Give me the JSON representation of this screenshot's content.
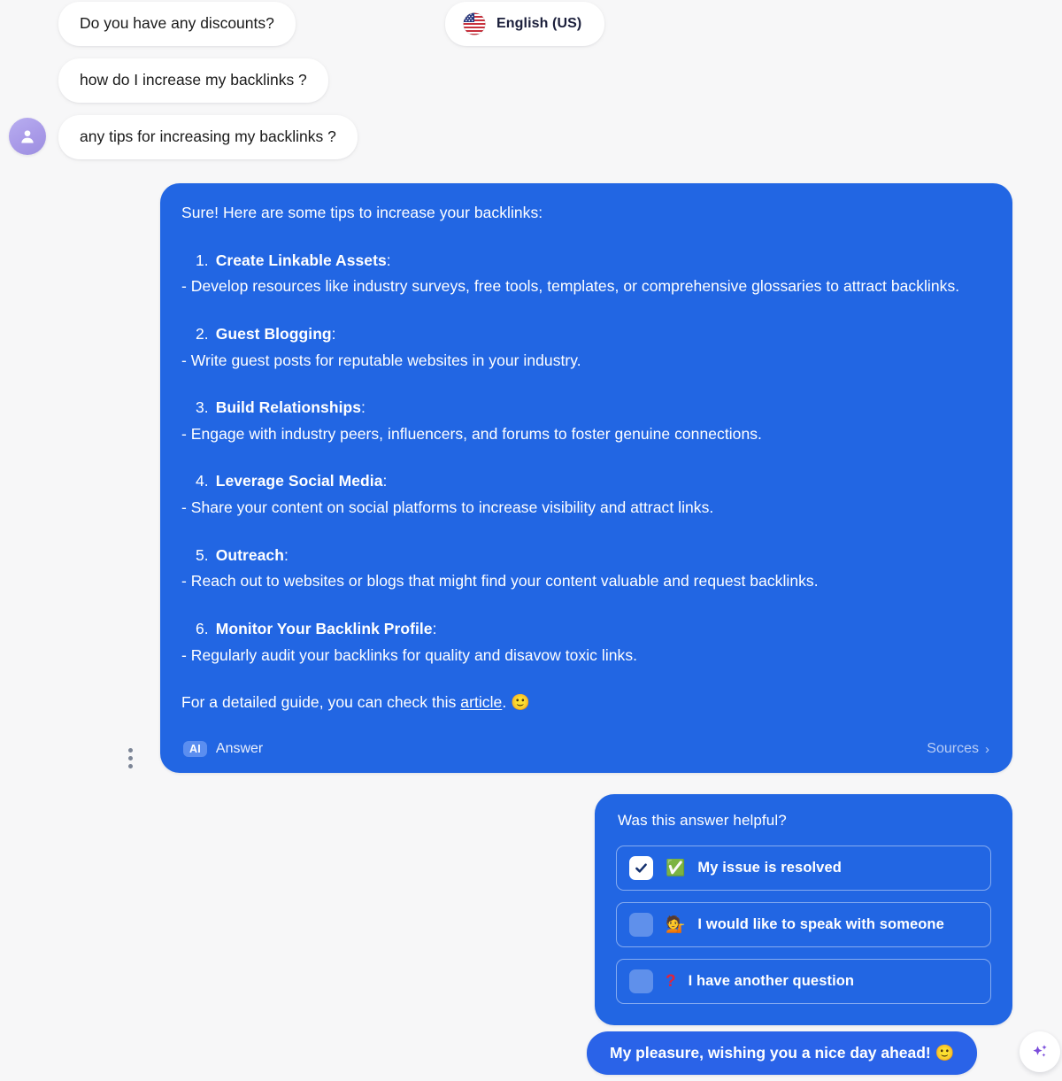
{
  "language_selector": {
    "label": "English (US)",
    "flag_icon": "us-flag-icon"
  },
  "user_messages": [
    {
      "text": "Do you have any discounts?"
    },
    {
      "text": "how do I increase my backlinks ?"
    },
    {
      "text": "any tips for increasing my backlinks ?"
    }
  ],
  "avatar": {
    "icon": "user-avatar-icon"
  },
  "answer": {
    "intro": "Sure! Here are some tips to increase your backlinks:",
    "tips": [
      {
        "number": "1.",
        "title": "Create Linkable Assets",
        "desc": "- Develop resources like industry surveys, free tools, templates, or comprehensive glossaries to attract backlinks."
      },
      {
        "number": "2.",
        "title": "Guest Blogging",
        "desc": "- Write guest posts for reputable websites in your industry."
      },
      {
        "number": "3.",
        "title": "Build Relationships",
        "desc": "- Engage with industry peers, influencers, and forums to foster genuine connections."
      },
      {
        "number": "4.",
        "title": "Leverage Social Media",
        "desc": "- Share your content on social platforms to increase visibility and attract links."
      },
      {
        "number": "5.",
        "title": "Outreach",
        "desc": "- Reach out to websites or blogs that might find your content valuable and request backlinks."
      },
      {
        "number": "6.",
        "title": "Monitor Your Backlink Profile",
        "desc": "- Regularly audit your backlinks for quality and disavow toxic links."
      }
    ],
    "closing_prefix": "For a detailed guide, you can check this ",
    "closing_link": "article",
    "closing_suffix": ". ",
    "closing_emoji": "🙂",
    "footer": {
      "badge": "AI",
      "label": "Answer",
      "sources_label": "Sources",
      "sources_chevron": "›"
    },
    "menu_icon": "kebab-menu-icon"
  },
  "feedback": {
    "title": "Was this answer helpful?",
    "options": [
      {
        "emoji": "✅",
        "label": "My issue is resolved",
        "checked": true
      },
      {
        "emoji": "💁",
        "label": "I would like to speak with someone",
        "checked": false
      },
      {
        "emoji": "?",
        "label": "I have another question",
        "checked": false
      }
    ]
  },
  "closing_message": {
    "text": "My pleasure, wishing you a nice day ahead! 🙂"
  },
  "sparkle_button": {
    "icon": "sparkle-icon"
  },
  "colors": {
    "page_background": "#f7f7f8",
    "bubble_blue": "#2266e3",
    "closing_bubble_blue": "#2a63e8",
    "ai_badge_blue": "#5b8ef0",
    "avatar_purple": "#a99ae8",
    "sparkle_purple": "#7b4ddb",
    "check_green": "#1db954"
  }
}
